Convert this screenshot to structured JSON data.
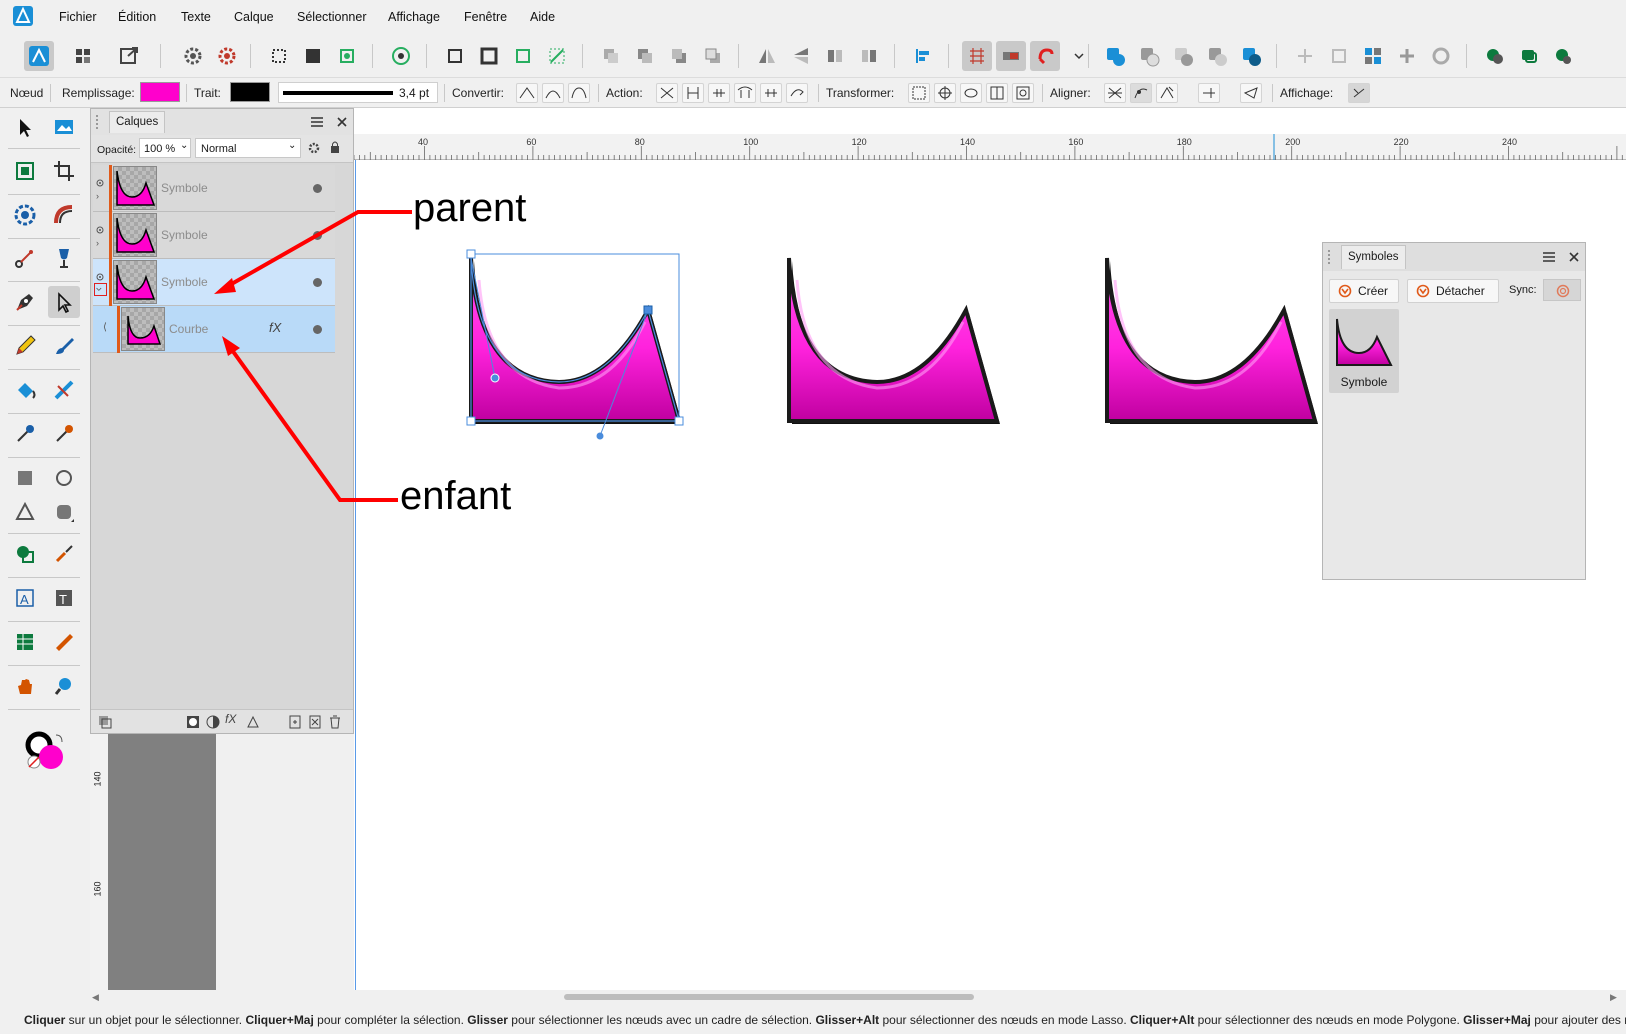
{
  "menu": [
    "Fichier",
    "Édition",
    "Texte",
    "Calque",
    "Sélectionner",
    "Affichage",
    "Fenêtre",
    "Aide"
  ],
  "context_bar": {
    "node_label": "Nœud",
    "fill_label": "Remplissage:",
    "fill_color": "#ff00cc",
    "stroke_label": "Trait:",
    "stroke_color": "#000000",
    "stroke_width": "3,4 pt",
    "convert_label": "Convertir:",
    "action_label": "Action:",
    "transform_label": "Transformer:",
    "align_label": "Aligner:",
    "display_label": "Affichage:"
  },
  "layers_panel": {
    "tab": "Calques",
    "opacity_label": "Opacité:",
    "opacity_value": "100 %",
    "blend_mode": "Normal",
    "rows": [
      {
        "name": "Symbole",
        "state": "normal"
      },
      {
        "name": "Symbole",
        "state": "normal"
      },
      {
        "name": "Symbole",
        "state": "selected"
      },
      {
        "name": "Courbe",
        "state": "child",
        "badge": "fX"
      }
    ]
  },
  "ruler": {
    "h_labels": [
      "40",
      "60",
      "80",
      "100",
      "120",
      "140",
      "160",
      "180",
      "200",
      "220",
      "240"
    ],
    "v_labels": [
      "140",
      "160"
    ]
  },
  "annotations": {
    "parent": "parent",
    "child": "enfant",
    "arrow_color": "#ff0000"
  },
  "symbols_panel": {
    "tab": "Symboles",
    "create": "Créer",
    "detach": "Détacher",
    "sync_label": "Sync:",
    "items": [
      {
        "name": "Symbole"
      }
    ]
  },
  "status": {
    "b1": "Cliquer",
    "t1": " sur un objet pour le sélectionner. ",
    "b2": "Cliquer+Maj",
    "t2": " pour compléter la sélection. ",
    "b3": "Glisser",
    "t3": " pour sélectionner les nœuds avec un cadre de sélection. ",
    "b4": "Glisser+Alt",
    "t4": " pour sélectionner des nœuds en mode Lasso. ",
    "b5": "Cliquer+Alt",
    "t5": " pour sélectionner des nœuds en mode Polygone. ",
    "b6": "Glisser+Maj",
    "t6": " pour ajouter des nœ"
  },
  "colors": {
    "accent": "#1a8fd6",
    "magenta": "#ff00cc",
    "selection_blue": "#cde4fb"
  }
}
